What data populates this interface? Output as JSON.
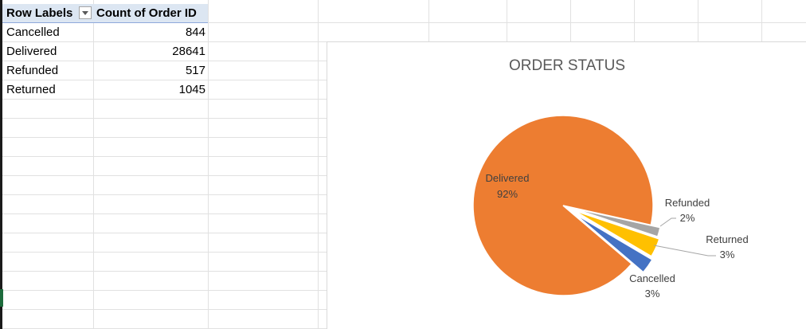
{
  "pivot": {
    "header_row_labels": "Row Labels",
    "header_count": "Count of Order ID",
    "rows": [
      {
        "label": "Cancelled",
        "value": "844"
      },
      {
        "label": "Delivered",
        "value": "28641"
      },
      {
        "label": "Refunded",
        "value": "517"
      },
      {
        "label": "Returned",
        "value": "1045"
      }
    ]
  },
  "chart_data": {
    "type": "pie",
    "title": "ORDER STATUS",
    "categories": [
      "Cancelled",
      "Delivered",
      "Refunded",
      "Returned"
    ],
    "values": [
      844,
      28641,
      517,
      1045
    ],
    "data_labels": [
      {
        "category": "Delivered",
        "percent": "92%"
      },
      {
        "category": "Refunded",
        "percent": "2%"
      },
      {
        "category": "Returned",
        "percent": "3%"
      },
      {
        "category": "Cancelled",
        "percent": "3%"
      }
    ],
    "colors": {
      "Cancelled": "#4472c4",
      "Delivered": "#ed7d31",
      "Refunded": "#a5a5a5",
      "Returned": "#ffc000"
    },
    "legend": "none",
    "exploded_slices": [
      "Cancelled",
      "Refunded",
      "Returned"
    ]
  }
}
